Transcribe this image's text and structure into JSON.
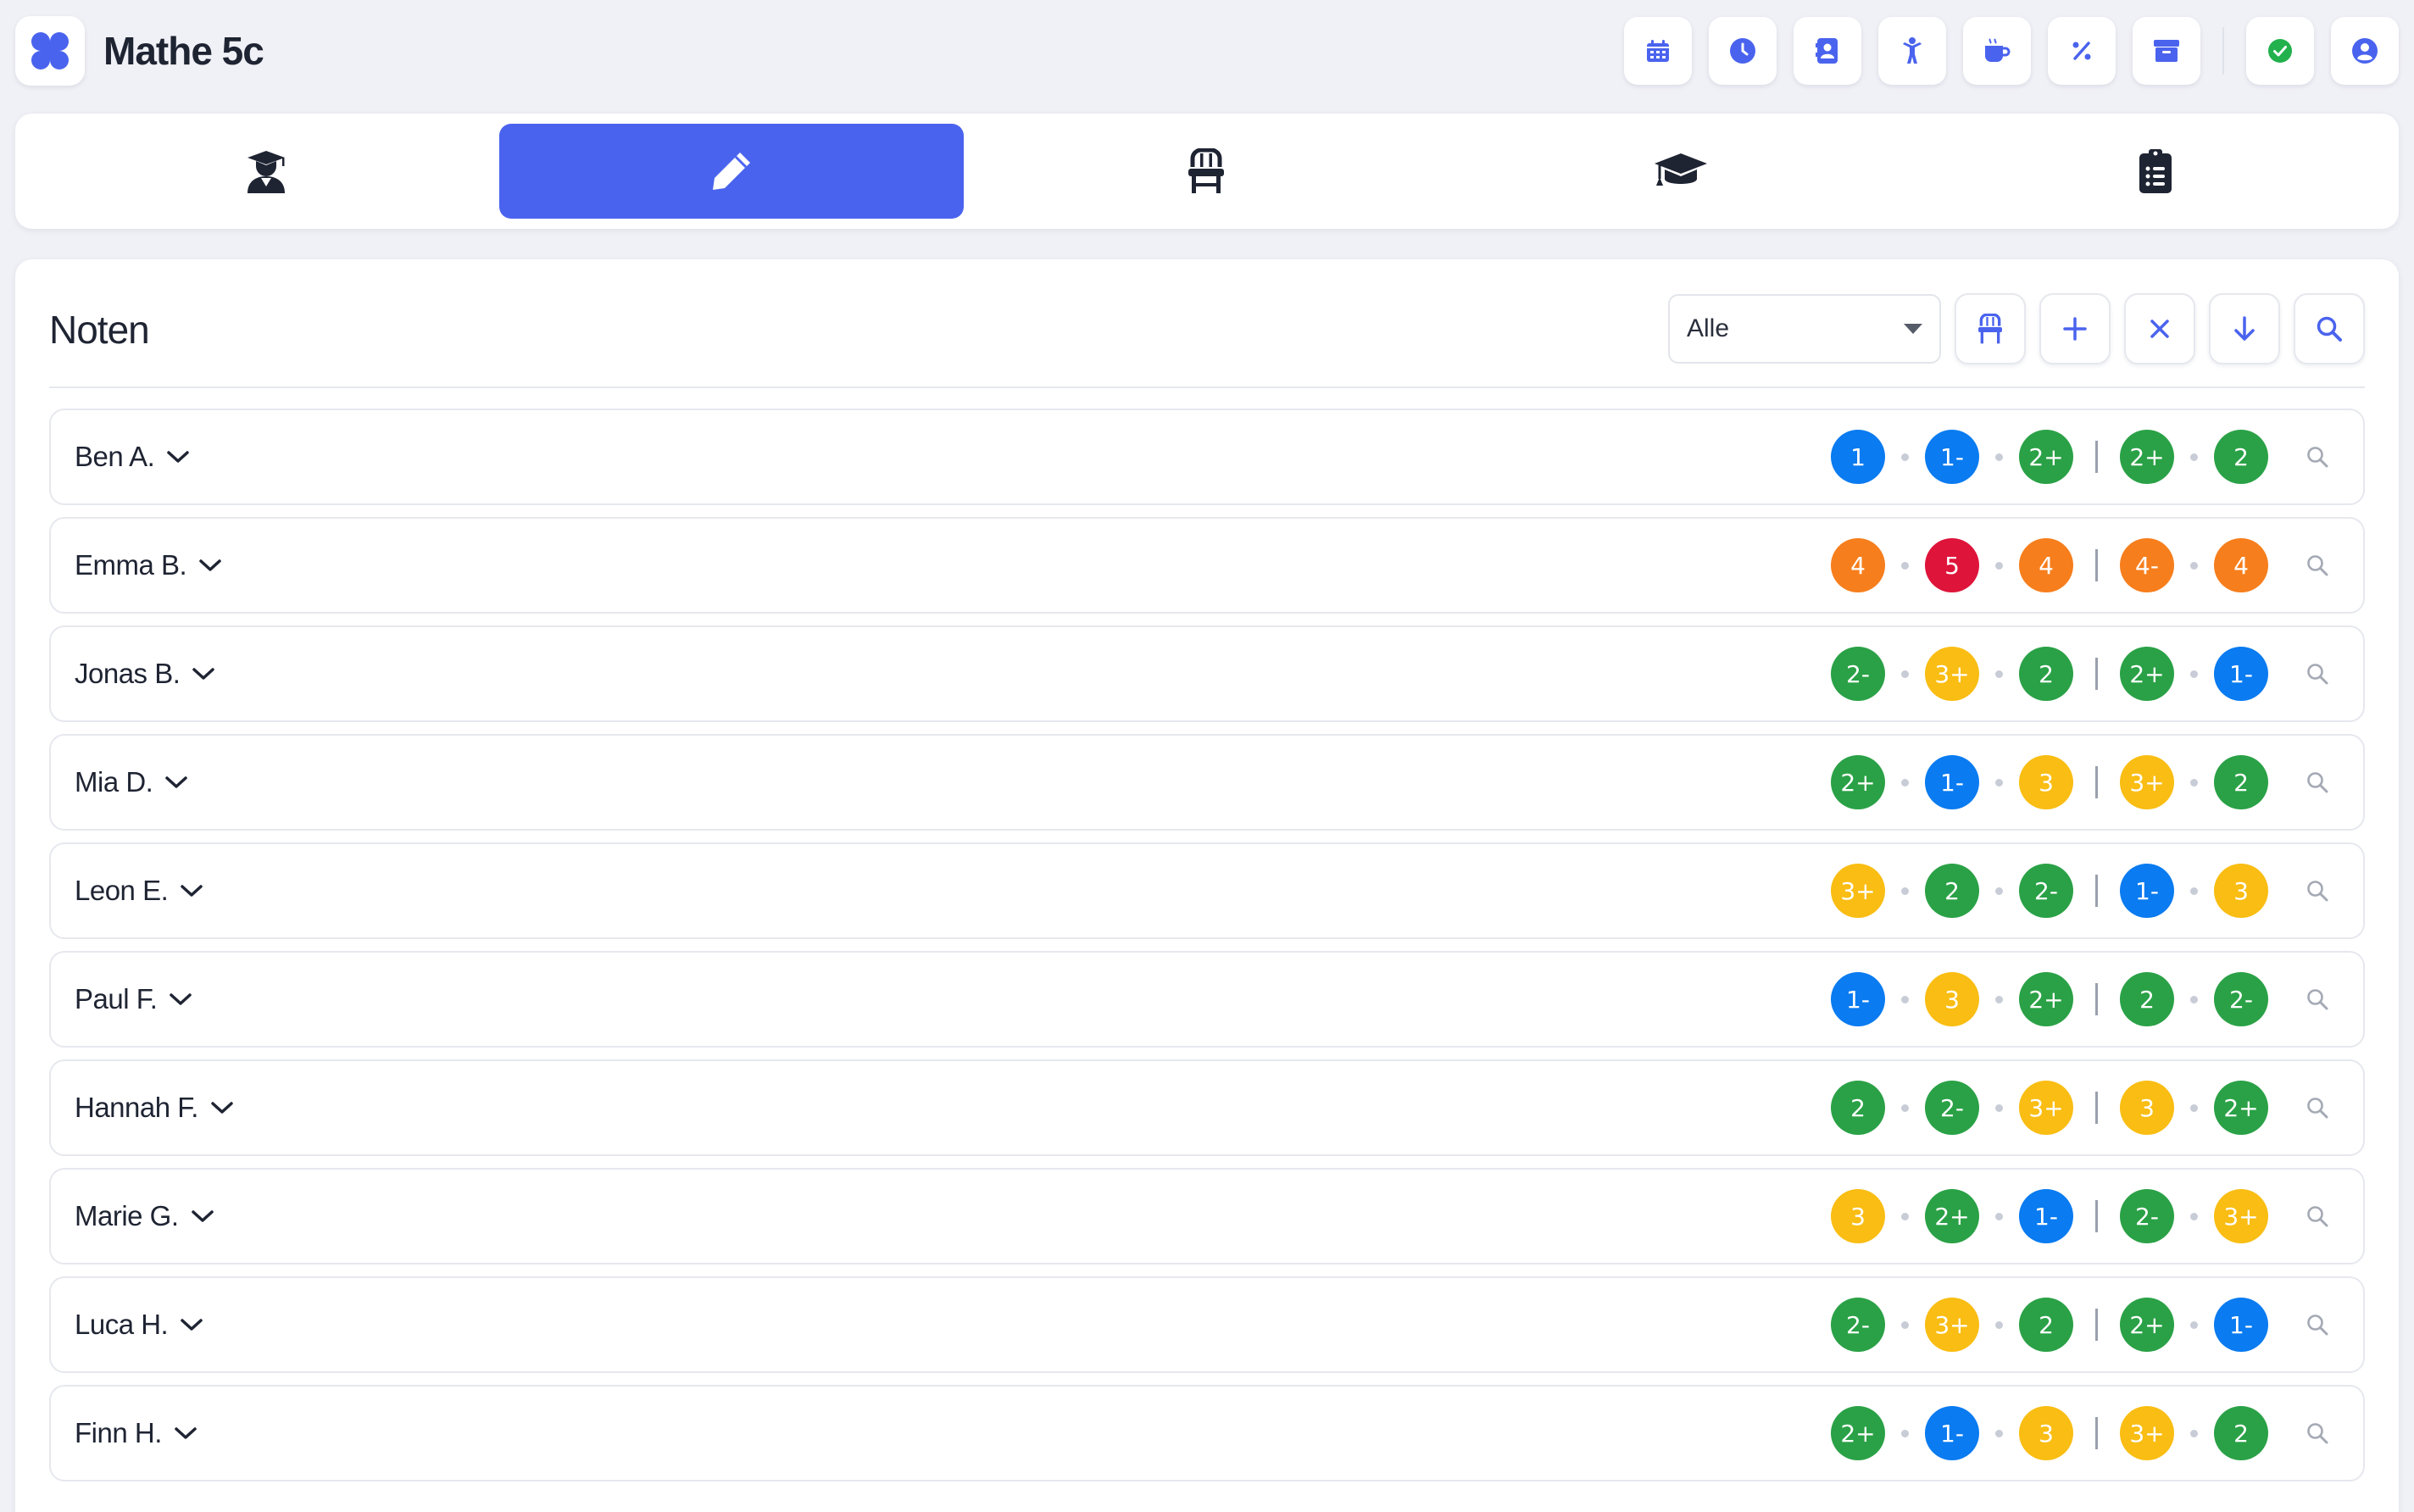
{
  "app": {
    "title": "Mathe 5c",
    "logo_icon": "four-blob-logo-icon",
    "accent": "#4a63ee"
  },
  "top_actions": [
    {
      "name": "calendar-icon"
    },
    {
      "name": "clock-icon"
    },
    {
      "name": "contacts-icon"
    },
    {
      "name": "person-icon"
    },
    {
      "name": "coffee-icon"
    },
    {
      "name": "percent-icon"
    },
    {
      "name": "archive-icon"
    },
    {
      "name": "check-status-icon",
      "color": "#22b14c"
    },
    {
      "name": "user-account-icon"
    }
  ],
  "tabs": [
    {
      "name": "student-icon",
      "active": false
    },
    {
      "name": "pencil-icon",
      "active": true
    },
    {
      "name": "chair-icon",
      "active": false
    },
    {
      "name": "graduation-cap-icon",
      "active": false
    },
    {
      "name": "clipboard-list-icon",
      "active": false
    }
  ],
  "section": {
    "title": "Noten",
    "filter_value": "Alle"
  },
  "toolbar_buttons": [
    {
      "name": "seating-icon"
    },
    {
      "name": "plus-icon"
    },
    {
      "name": "close-icon"
    },
    {
      "name": "arrow-down-icon"
    },
    {
      "name": "search-icon"
    }
  ],
  "grade_colors": {
    "1": "#0a7bf0",
    "2": "#2aa146",
    "3": "#f9bd13",
    "4": "#f67e1c",
    "5": "#de143a"
  },
  "students": [
    {
      "name": "Ben A.",
      "grades": [
        "1",
        "1-",
        "2+"
      ],
      "summary": [
        "2+",
        "2"
      ]
    },
    {
      "name": "Emma B.",
      "grades": [
        "4",
        "5",
        "4"
      ],
      "summary": [
        "4-",
        "4"
      ]
    },
    {
      "name": "Jonas B.",
      "grades": [
        "2-",
        "3+",
        "2"
      ],
      "summary": [
        "2+",
        "1-"
      ]
    },
    {
      "name": "Mia D.",
      "grades": [
        "2+",
        "1-",
        "3"
      ],
      "summary": [
        "3+",
        "2"
      ]
    },
    {
      "name": "Leon E.",
      "grades": [
        "3+",
        "2",
        "2-"
      ],
      "summary": [
        "1-",
        "3"
      ]
    },
    {
      "name": "Paul F.",
      "grades": [
        "1-",
        "3",
        "2+"
      ],
      "summary": [
        "2",
        "2-"
      ]
    },
    {
      "name": "Hannah F.",
      "grades": [
        "2",
        "2-",
        "3+"
      ],
      "summary": [
        "3",
        "2+"
      ]
    },
    {
      "name": "Marie G.",
      "grades": [
        "3",
        "2+",
        "1-"
      ],
      "summary": [
        "2-",
        "3+"
      ]
    },
    {
      "name": "Luca H.",
      "grades": [
        "2-",
        "3+",
        "2"
      ],
      "summary": [
        "2+",
        "1-"
      ]
    },
    {
      "name": "Finn H.",
      "grades": [
        "2+",
        "1-",
        "3"
      ],
      "summary": [
        "3+",
        "2"
      ]
    }
  ]
}
